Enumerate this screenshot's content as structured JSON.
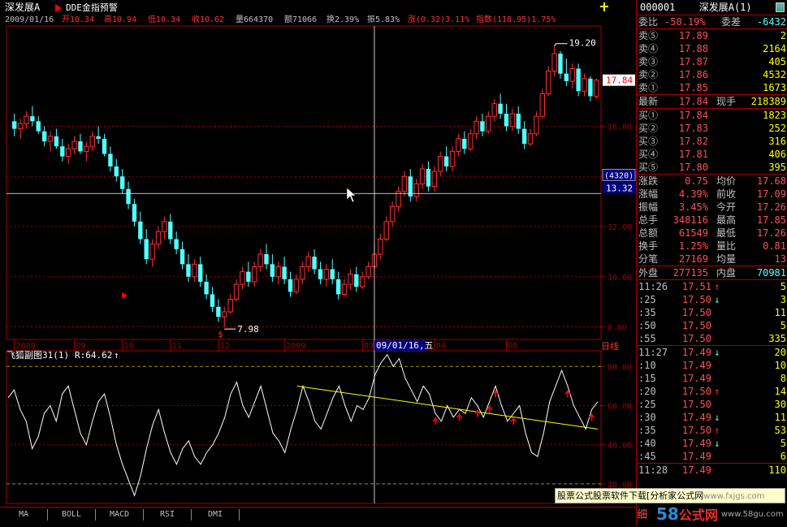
{
  "header": {
    "stock_name": "深发展A",
    "indicator_name": "DDE金指预警",
    "date": "2009/01/16",
    "open": "开10.34",
    "high": "高10.94",
    "low": "低10.34",
    "close": "收10.62",
    "volume": "量664370",
    "amount": "额71066",
    "turnover": "换2.39%",
    "amplitude": "振5.83%",
    "change": "涨(0.32)3.11%",
    "index": "指数(118.95)1.75%"
  },
  "colors": {
    "up": "#ff3030",
    "down": "#54ffff",
    "grid": "#a00000",
    "indicator_line": "#ffffff",
    "trend_line": "#ffff00",
    "buy_signal": "#ff0000"
  },
  "icons": {
    "play": "triangle-right-icon",
    "pin": "pin-icon",
    "color": "color-swatch-icon",
    "cursor": "mouse-pointer-icon"
  },
  "chart_data": [
    {
      "type": "candlestick",
      "title": "深发展A",
      "y_ticks": [
        8.0,
        10.0,
        12.0,
        14.0,
        16.0
      ],
      "ylim": [
        7.5,
        20.0
      ],
      "x_labels": [
        "2008",
        "09",
        "10",
        "11",
        "12",
        "2009",
        "03",
        "04",
        "05"
      ],
      "period": "日线",
      "cursor_date": "09/01/16,五",
      "cursor_price": "13.32",
      "cursor_count": "(4320)",
      "last_price_tag": "17.84",
      "high_annotation": "19.20",
      "low_annotation": "7.98",
      "candles": [
        [
          16.2,
          16.5,
          15.6,
          15.9
        ],
        [
          15.9,
          16.3,
          15.5,
          16.1
        ],
        [
          16.1,
          16.6,
          15.9,
          16.4
        ],
        [
          16.4,
          16.8,
          16.0,
          16.2
        ],
        [
          16.2,
          16.4,
          15.7,
          15.8
        ],
        [
          15.8,
          16.0,
          15.2,
          15.4
        ],
        [
          15.4,
          15.8,
          15.0,
          15.6
        ],
        [
          15.6,
          15.9,
          15.1,
          15.2
        ],
        [
          15.2,
          15.5,
          14.6,
          14.8
        ],
        [
          14.8,
          15.3,
          14.5,
          15.1
        ],
        [
          15.1,
          15.6,
          14.9,
          15.4
        ],
        [
          15.4,
          15.7,
          14.9,
          15.0
        ],
        [
          15.0,
          15.4,
          14.6,
          15.2
        ],
        [
          15.2,
          15.8,
          15.0,
          15.6
        ],
        [
          15.6,
          16.0,
          15.3,
          15.5
        ],
        [
          15.5,
          15.7,
          14.8,
          14.9
        ],
        [
          14.9,
          15.2,
          14.2,
          14.4
        ],
        [
          14.4,
          14.7,
          13.8,
          14.0
        ],
        [
          14.0,
          14.3,
          13.3,
          13.5
        ],
        [
          13.5,
          13.8,
          12.7,
          12.9
        ],
        [
          12.9,
          13.1,
          12.0,
          12.2
        ],
        [
          12.2,
          12.6,
          11.3,
          11.5
        ],
        [
          11.5,
          11.9,
          10.5,
          10.7
        ],
        [
          10.7,
          11.5,
          10.4,
          11.3
        ],
        [
          11.3,
          12.0,
          11.1,
          11.8
        ],
        [
          11.8,
          12.4,
          11.5,
          12.2
        ],
        [
          12.2,
          12.5,
          11.3,
          11.5
        ],
        [
          11.5,
          11.8,
          10.9,
          11.1
        ],
        [
          11.1,
          11.4,
          10.3,
          10.5
        ],
        [
          10.5,
          10.9,
          9.8,
          10.0
        ],
        [
          10.0,
          10.7,
          9.8,
          10.5
        ],
        [
          10.5,
          10.8,
          9.6,
          9.8
        ],
        [
          9.8,
          10.1,
          9.1,
          9.3
        ],
        [
          9.3,
          9.6,
          8.6,
          8.8
        ],
        [
          8.8,
          9.1,
          8.2,
          8.4
        ],
        [
          8.4,
          8.8,
          7.98,
          8.6
        ],
        [
          8.6,
          9.3,
          8.5,
          9.1
        ],
        [
          9.1,
          9.9,
          9.0,
          9.7
        ],
        [
          9.7,
          10.4,
          9.5,
          10.2
        ],
        [
          10.2,
          10.6,
          9.6,
          9.8
        ],
        [
          9.8,
          10.6,
          9.6,
          10.4
        ],
        [
          10.4,
          11.1,
          10.2,
          10.9
        ],
        [
          10.9,
          11.3,
          10.3,
          10.5
        ],
        [
          10.5,
          10.9,
          9.8,
          10.0
        ],
        [
          10.0,
          10.6,
          9.7,
          10.4
        ],
        [
          10.4,
          10.8,
          9.7,
          9.9
        ],
        [
          9.9,
          10.2,
          9.2,
          9.4
        ],
        [
          9.4,
          10.1,
          9.3,
          9.9
        ],
        [
          9.9,
          10.6,
          9.7,
          10.4
        ],
        [
          10.4,
          11.0,
          10.2,
          10.8
        ],
        [
          10.8,
          11.1,
          10.1,
          10.3
        ],
        [
          10.3,
          10.6,
          9.7,
          9.9
        ],
        [
          9.9,
          10.5,
          9.6,
          10.3
        ],
        [
          10.3,
          10.7,
          9.7,
          9.9
        ],
        [
          9.9,
          10.2,
          9.1,
          9.3
        ],
        [
          9.3,
          9.9,
          9.2,
          9.7
        ],
        [
          9.7,
          10.3,
          9.5,
          10.1
        ],
        [
          10.1,
          10.4,
          9.4,
          9.6
        ],
        [
          9.6,
          10.2,
          9.5,
          10.0
        ],
        [
          10.0,
          10.6,
          9.9,
          10.4
        ],
        [
          10.4,
          11.3,
          10.34,
          10.9
        ],
        [
          10.9,
          11.7,
          10.7,
          11.5
        ],
        [
          11.5,
          12.4,
          11.4,
          12.2
        ],
        [
          12.2,
          13.0,
          12.0,
          12.8
        ],
        [
          12.8,
          13.6,
          12.6,
          13.4
        ],
        [
          13.4,
          14.2,
          13.2,
          14.0
        ],
        [
          14.0,
          14.3,
          13.0,
          13.2
        ],
        [
          13.2,
          13.9,
          13.0,
          13.7
        ],
        [
          13.7,
          14.5,
          13.5,
          14.3
        ],
        [
          14.3,
          14.6,
          13.4,
          13.6
        ],
        [
          13.6,
          14.4,
          13.4,
          14.2
        ],
        [
          14.2,
          15.0,
          14.0,
          14.8
        ],
        [
          14.8,
          15.2,
          14.2,
          14.4
        ],
        [
          14.4,
          15.2,
          14.2,
          15.0
        ],
        [
          15.0,
          15.7,
          14.8,
          15.5
        ],
        [
          15.5,
          15.8,
          14.9,
          15.1
        ],
        [
          15.1,
          15.9,
          15.0,
          15.7
        ],
        [
          15.7,
          16.4,
          15.5,
          16.2
        ],
        [
          16.2,
          16.5,
          15.6,
          15.8
        ],
        [
          15.8,
          16.6,
          15.7,
          16.4
        ],
        [
          16.4,
          17.1,
          16.2,
          16.9
        ],
        [
          16.9,
          17.3,
          16.3,
          16.5
        ],
        [
          16.5,
          16.9,
          15.8,
          16.0
        ],
        [
          16.0,
          16.7,
          15.8,
          16.5
        ],
        [
          16.5,
          16.8,
          15.7,
          15.9
        ],
        [
          15.9,
          16.2,
          15.1,
          15.3
        ],
        [
          15.3,
          15.9,
          15.2,
          15.7
        ],
        [
          15.7,
          16.6,
          15.6,
          16.4
        ],
        [
          16.4,
          17.5,
          16.3,
          17.3
        ],
        [
          17.3,
          18.4,
          17.2,
          18.2
        ],
        [
          18.2,
          19.2,
          18.0,
          18.9
        ],
        [
          18.9,
          19.0,
          17.9,
          18.1
        ],
        [
          18.1,
          18.7,
          17.6,
          17.8
        ],
        [
          17.8,
          18.5,
          17.5,
          18.3
        ],
        [
          18.3,
          18.5,
          17.2,
          17.4
        ],
        [
          17.4,
          18.1,
          17.2,
          17.9
        ],
        [
          17.9,
          18.0,
          17.0,
          17.2
        ],
        [
          17.2,
          17.9,
          17.1,
          17.84
        ]
      ]
    },
    {
      "type": "line",
      "title": "飞狐副图31(1)",
      "readout": "R:64.62",
      "y_ticks": [
        20.0,
        40.0,
        60.0,
        80.0
      ],
      "ylim": [
        10,
        88
      ],
      "values": [
        64,
        68,
        58,
        52,
        38,
        44,
        56,
        60,
        52,
        66,
        70,
        58,
        46,
        40,
        52,
        62,
        66,
        54,
        40,
        30,
        22,
        14,
        24,
        38,
        50,
        58,
        46,
        36,
        30,
        38,
        42,
        34,
        30,
        36,
        40,
        46,
        54,
        66,
        72,
        60,
        54,
        62,
        70,
        58,
        46,
        42,
        36,
        48,
        58,
        70,
        62,
        52,
        48,
        56,
        64,
        70,
        60,
        52,
        60,
        58,
        64,
        76,
        82,
        86,
        80,
        84,
        74,
        68,
        62,
        70,
        66,
        56,
        52,
        60,
        54,
        58,
        56,
        64,
        60,
        54,
        62,
        70,
        60,
        52,
        56,
        60,
        46,
        36,
        34,
        46,
        62,
        70,
        78,
        70,
        60,
        54,
        48,
        58,
        62
      ],
      "trend_line": {
        "start": [
          48,
          70
        ],
        "end": [
          98,
          48
        ]
      },
      "signals": [
        71,
        75,
        78,
        80,
        81,
        84,
        93,
        97
      ],
      "ref_lines": [
        80,
        20
      ]
    }
  ],
  "quote": {
    "code": "000001",
    "name": "深发展A(1)",
    "webi": {
      "label": "委比",
      "value": "-50.19%",
      "label2": "委差",
      "value2": "-6432"
    },
    "sells": [
      {
        "label": "卖⑤",
        "price": "17.89",
        "vol": "2"
      },
      {
        "label": "卖④",
        "price": "17.88",
        "vol": "2164"
      },
      {
        "label": "卖③",
        "price": "17.87",
        "vol": "405"
      },
      {
        "label": "卖②",
        "price": "17.86",
        "vol": "4532"
      },
      {
        "label": "卖①",
        "price": "17.85",
        "vol": "1673"
      }
    ],
    "latest": {
      "label": "最新",
      "value": "17.84",
      "label2": "现手",
      "value2": "218389"
    },
    "buys": [
      {
        "label": "买①",
        "price": "17.84",
        "vol": "1823"
      },
      {
        "label": "买②",
        "price": "17.83",
        "vol": "252"
      },
      {
        "label": "买③",
        "price": "17.82",
        "vol": "316"
      },
      {
        "label": "买④",
        "price": "17.81",
        "vol": "406"
      },
      {
        "label": "买⑤",
        "price": "17.80",
        "vol": "395"
      }
    ],
    "stats": [
      {
        "l1": "涨跌",
        "v1": "0.75",
        "l2": "均价",
        "v2": "17.68"
      },
      {
        "l1": "涨幅",
        "v1": "4.39%",
        "l2": "前收",
        "v2": "17.09"
      },
      {
        "l1": "振幅",
        "v1": "3.45%",
        "l2": "今开",
        "v2": "17.26"
      },
      {
        "l1": "总手",
        "v1": "348116",
        "l2": "最高",
        "v2": "17.85"
      },
      {
        "l1": "总额",
        "v1": "61549",
        "l2": "最低",
        "v2": "17.26"
      },
      {
        "l1": "换手",
        "v1": "1.25%",
        "l2": "量比",
        "v2": "0.81"
      },
      {
        "l1": "分笔",
        "v1": "27169",
        "l2": "均量",
        "v2": "13"
      }
    ],
    "outer": {
      "l1": "外盘",
      "v1": "277135",
      "l2": "内盘",
      "v2": "70981"
    },
    "ticks1": [
      {
        "t": "11:26",
        "p": "17.51",
        "a": "↑",
        "v": "5"
      },
      {
        "t": ":25",
        "p": "17.50",
        "a": "↓",
        "v": "3"
      },
      {
        "t": ":35",
        "p": "17.50",
        "a": "",
        "v": "11"
      },
      {
        "t": ":50",
        "p": "17.50",
        "a": "",
        "v": "5"
      },
      {
        "t": ":55",
        "p": "17.50",
        "a": "",
        "v": "335"
      }
    ],
    "ticks2": [
      {
        "t": "11:27",
        "p": "17.49",
        "a": "↓",
        "v": "20"
      },
      {
        "t": ":10",
        "p": "17.49",
        "a": "",
        "v": "10"
      },
      {
        "t": ":15",
        "p": "17.49",
        "a": "",
        "v": "8"
      },
      {
        "t": ":20",
        "p": "17.50",
        "a": "↑",
        "v": "14"
      },
      {
        "t": ":25",
        "p": "17.50",
        "a": "",
        "v": "30"
      },
      {
        "t": ":30",
        "p": "17.49",
        "a": "↓",
        "v": "11"
      },
      {
        "t": ":35",
        "p": "17.50",
        "a": "↑",
        "v": "53"
      },
      {
        "t": ":40",
        "p": "17.49",
        "a": "↓",
        "v": "5"
      },
      {
        "t": ":45",
        "p": "17.49",
        "a": "",
        "v": "6"
      }
    ],
    "ticks3": [
      {
        "t": "11:28",
        "p": "17.49",
        "a": "",
        "v": "110"
      }
    ],
    "detail_label": "细"
  },
  "tabs": [
    "MA",
    "BOLL",
    "MACD",
    "RSI",
    "DMI"
  ],
  "ad": {
    "text": "股票公式股票软件下载[分析家公式网",
    "url": "www.fxjgs.com"
  },
  "watermark": {
    "brand_num": "58",
    "brand_cn": "公式网",
    "url": "www.58gu.com"
  }
}
